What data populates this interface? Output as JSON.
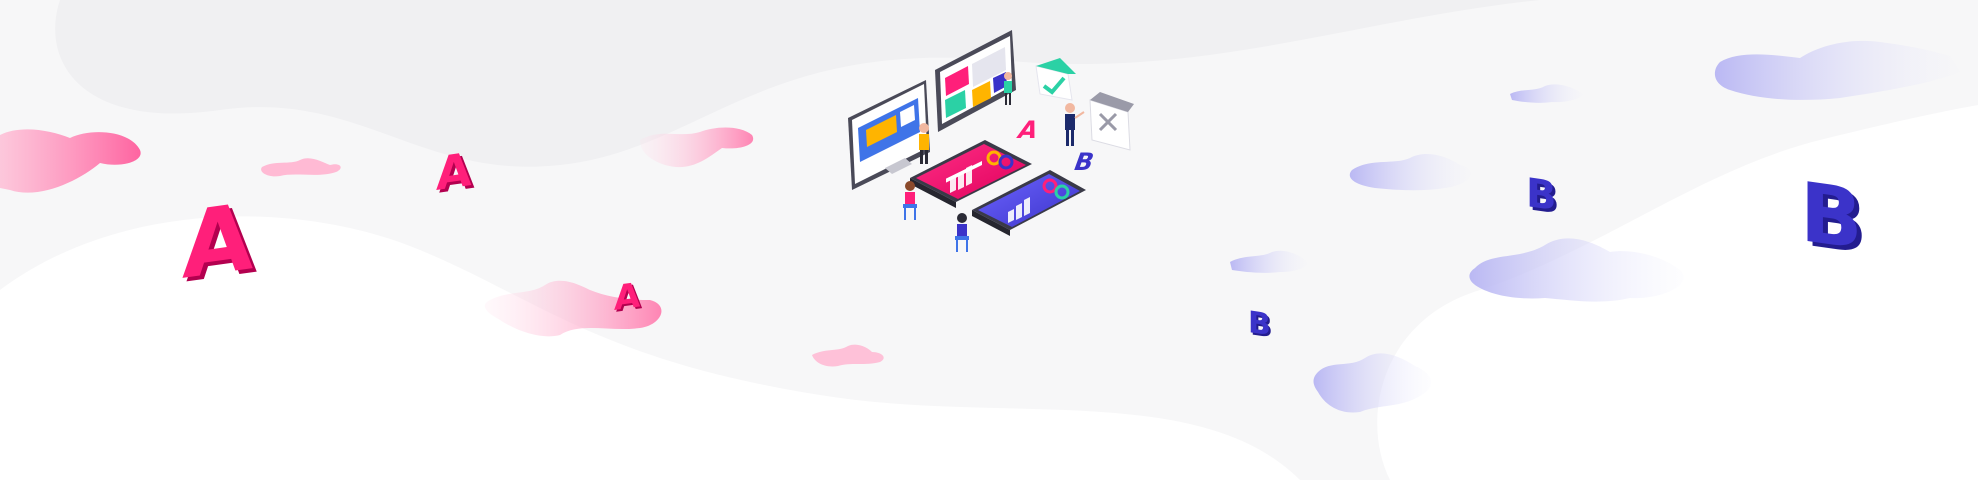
{
  "scene": {
    "letter_a": "A",
    "letter_b": "B"
  },
  "colors": {
    "background": "#f7f7f8",
    "wave_white": "#ffffff",
    "pink_accent": "#ff1f7a",
    "pink_cloud": "#ff9fc4",
    "purple_accent": "#3b33c9",
    "purple_cloud": "#c8c7f5",
    "teal_accent": "#2bd1a5"
  }
}
